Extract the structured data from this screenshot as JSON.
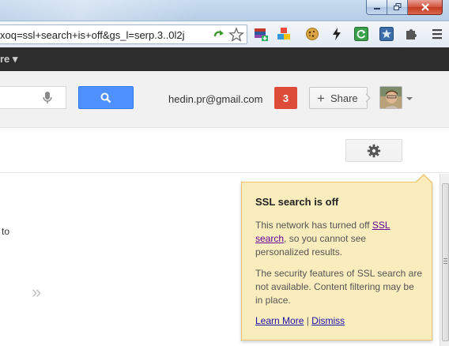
{
  "browser": {
    "address_text": "xoq=ssl+search+is+off&gs_l=serp.3..0l2j",
    "extensions": [
      "colorful-stack-icon",
      "cubes-icon",
      "cookie-icon",
      "lightning-icon",
      "refresh-icon",
      "star-box-icon",
      "puzzle-icon",
      "menu-icon"
    ]
  },
  "gbar": {
    "more_label": "re ▾"
  },
  "header": {
    "email": "hedin.pr@gmail.com",
    "notification_count": "3",
    "share_label": "Share"
  },
  "body": {
    "partial_text": "to",
    "chevrons": "»"
  },
  "bubble": {
    "title": "SSL search is off",
    "p1_before": "This network has turned off ",
    "p1_link": "SSL search",
    "p1_after": ", so you cannot see personalized results.",
    "p2": "The security features of SSL search are not available. Content filtering may be in place.",
    "learn_more": "Learn More",
    "separator": " | ",
    "dismiss": "Dismiss"
  },
  "colors": {
    "accent_blue": "#4d90fe",
    "notification_red": "#dd4b39",
    "bubble_bg": "#f9edbe",
    "bubble_border": "#f0c36d"
  }
}
